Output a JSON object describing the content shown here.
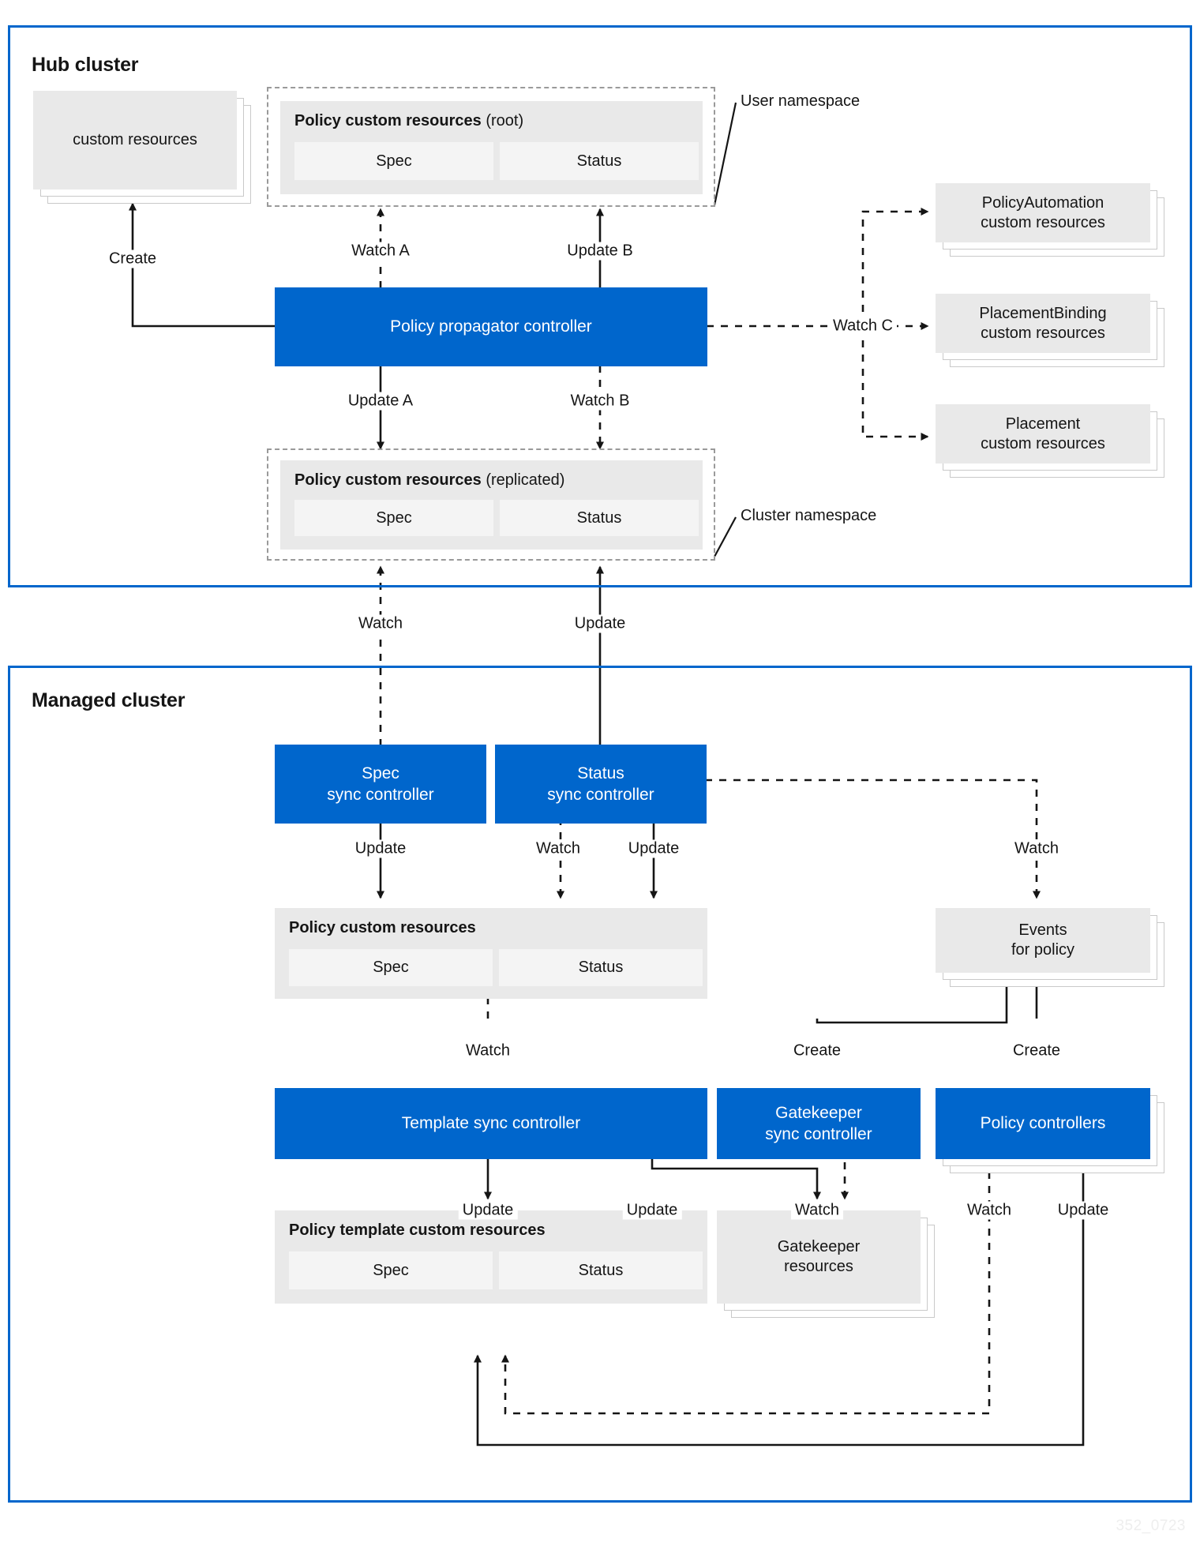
{
  "diagram": {
    "watermark": "352_0723",
    "colors": {
      "brand_blue": "#0066cc",
      "gray_box": "#e9e9e9",
      "subfield": "#f4f4f4",
      "dashed_border": "#9a9a9a",
      "text": "#151515"
    }
  },
  "hub": {
    "title": "Hub cluster",
    "custom_resources": "custom resources",
    "root_policy": {
      "title_bold": "Policy custom resources",
      "title_paren": "(root)",
      "spec": "Spec",
      "status": "Status"
    },
    "replicated_policy": {
      "title_bold": "Policy custom resources",
      "title_paren": "(replicated)",
      "spec": "Spec",
      "status": "Status"
    },
    "user_namespace_label": "User namespace",
    "cluster_namespace_label": "Cluster namespace",
    "propagator": "Policy propagator controller",
    "right_resources": [
      {
        "line1": "PolicyAutomation",
        "line2": "custom resources"
      },
      {
        "line1": "PlacementBinding",
        "line2": "custom resources"
      },
      {
        "line1": "Placement",
        "line2": "custom resources"
      }
    ],
    "edges": {
      "create": "Create",
      "watch_a": "Watch A",
      "update_b": "Update B",
      "update_a": "Update A",
      "watch_b": "Watch B",
      "watch_c": "Watch C"
    }
  },
  "bridge": {
    "watch": "Watch",
    "update": "Update"
  },
  "managed": {
    "title": "Managed cluster",
    "spec_sync": {
      "line1": "Spec",
      "line2": "sync controller"
    },
    "status_sync": {
      "line1": "Status",
      "line2": "sync controller"
    },
    "policy_cr": {
      "title_bold": "Policy custom resources",
      "spec": "Spec",
      "status": "Status"
    },
    "events": {
      "line1": "Events",
      "line2": "for policy"
    },
    "template_sync": "Template sync controller",
    "gatekeeper_sync": {
      "line1": "Gatekeeper",
      "line2": "sync controller"
    },
    "policy_controllers": "Policy controllers",
    "policy_template_cr": {
      "title_bold": "Policy template custom resources",
      "spec": "Spec",
      "status": "Status"
    },
    "gatekeeper_resources": {
      "line1": "Gatekeeper",
      "line2": "resources"
    },
    "edges": {
      "spec_update": "Update",
      "status_watch": "Watch",
      "status_update": "Update",
      "events_watch": "Watch",
      "template_watch": "Watch",
      "gk_create": "Create",
      "pc_create": "Create",
      "template_update_left": "Update",
      "template_update_right": "Update",
      "gk_watch": "Watch",
      "pc_watch": "Watch",
      "pc_update": "Update"
    }
  }
}
